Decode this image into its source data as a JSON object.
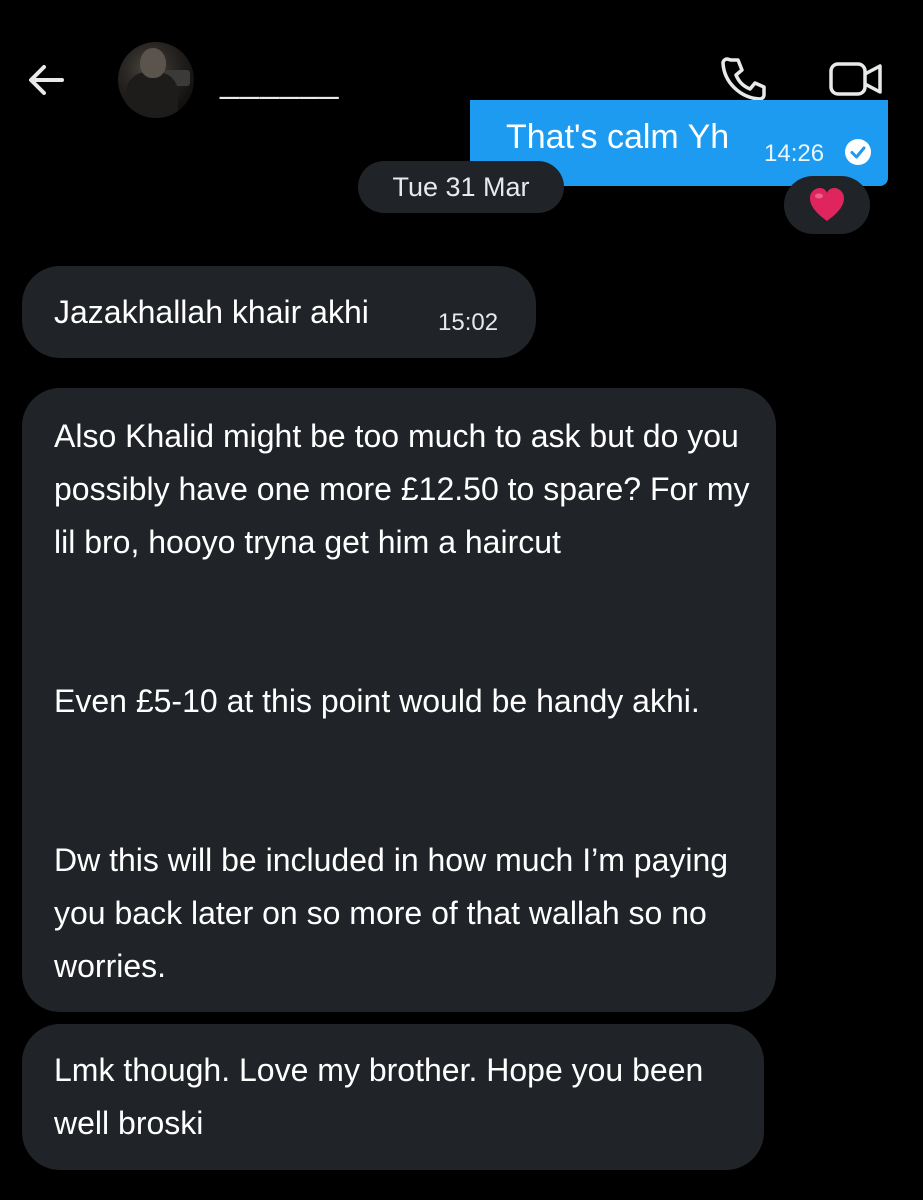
{
  "header": {
    "back_icon": "arrow-left-icon",
    "contact_name": "______",
    "call_icon": "phone-icon",
    "video_icon": "video-camera-icon"
  },
  "conversation": {
    "outgoing": {
      "text": "That's calm Yh",
      "time": "14:26",
      "status_icon": "read-check-icon",
      "reaction": "❤️"
    },
    "date_separator": "Tue 31 Mar",
    "incoming": [
      {
        "text": "Jazakhallah khair akhi",
        "time": "15:02"
      },
      {
        "paragraphs": [
          "Also Khalid might be too much to ask but do you possibly have one more £12.50 to spare? For my lil bro, hooyo tryna get him a haircut",
          "Even £5-10 at this point would be handy akhi.",
          "Dw this will be included in how much I’m paying you back later on so more of that wallah so no worries."
        ]
      },
      {
        "text": "Lmk though. Love my brother. Hope you been well broski"
      }
    ]
  },
  "colors": {
    "background": "#000000",
    "incoming_bubble": "#202327",
    "outgoing_bubble": "#1d9bf0",
    "reaction_heart": "#e0245e"
  }
}
